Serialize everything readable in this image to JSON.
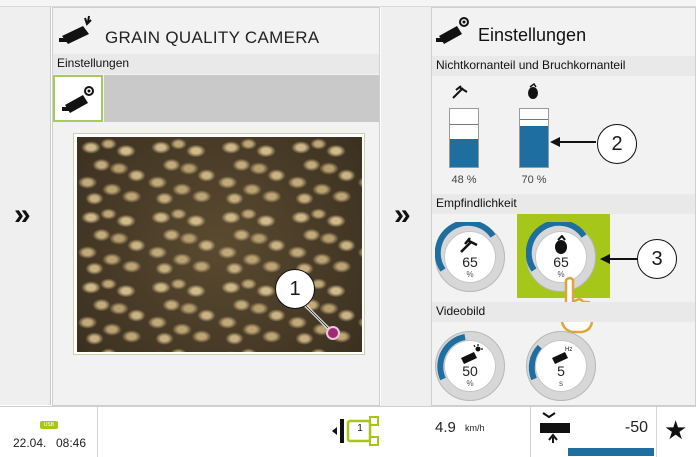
{
  "left_panel": {
    "title": "GRAIN QUALITY CAMERA",
    "section_label": "Einstellungen",
    "icon": "camera-grain-icon",
    "callout_1": "1"
  },
  "right_panel": {
    "title": "Einstellungen",
    "icon": "camera-settings-icon",
    "section_ratio": "Nichtkornanteil und Bruchkornanteil",
    "bars": [
      {
        "icon": "impurity-icon",
        "label": "48 %",
        "level": 0.48
      },
      {
        "icon": "broken-grain-icon",
        "label": "70 %",
        "level": 0.7
      }
    ],
    "callout_2": "2",
    "section_sensitivity": "Empfindlichkeit",
    "sensitivity_gauges": [
      {
        "icon": "impurity-icon",
        "value": "65",
        "unit": "%"
      },
      {
        "icon": "broken-grain-icon",
        "value": "65",
        "unit": "%"
      }
    ],
    "callout_3": "3",
    "section_video": "Videobild",
    "video_gauges": [
      {
        "icon": "brightness-camera-icon",
        "value": "50",
        "unit": "%"
      },
      {
        "icon": "frequency-camera-icon",
        "value": "5",
        "unit": "s"
      }
    ]
  },
  "nav": {
    "expand_left": "»",
    "expand_mid": "»"
  },
  "status_bar": {
    "usb_label": "USB",
    "date": "22.04.",
    "time": "08:46",
    "gear_number": "1",
    "speed": "4.9",
    "speed_unit": "km/h",
    "header_value": "-50",
    "favorite": "★"
  },
  "colors": {
    "accent_green": "#a7c61a",
    "bar_blue": "#1e6fa0"
  }
}
